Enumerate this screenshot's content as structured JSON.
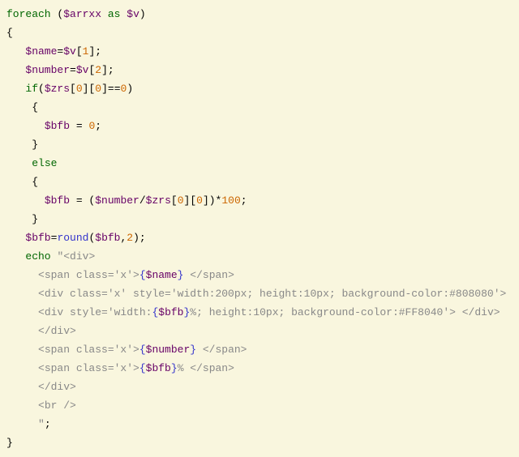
{
  "code": {
    "l1": {
      "kw1": "foreach",
      "p1": " (",
      "v1": "$arrxx",
      "p2": " ",
      "kw2": "as",
      "p3": " ",
      "v2": "$v",
      "p4": ")"
    },
    "l2": "{",
    "l3": "",
    "l4": {
      "ind": "   ",
      "v1": "$name",
      "p1": "=",
      "v2": "$v",
      "p2": "[",
      "n1": "1",
      "p3": "];"
    },
    "l5": {
      "ind": "   ",
      "v1": "$number",
      "p1": "=",
      "v2": "$v",
      "p2": "[",
      "n1": "2",
      "p3": "];"
    },
    "l6": {
      "ind": "   ",
      "kw": "if",
      "p1": "(",
      "v1": "$zrs",
      "p2": "[",
      "n1": "0",
      "p3": "][",
      "n2": "0",
      "p4": "]==",
      "n3": "0",
      "p5": ")"
    },
    "l7": {
      "ind": "    ",
      "t": "{"
    },
    "l8": {
      "ind": "      ",
      "v1": "$bfb",
      "p1": " = ",
      "n1": "0",
      "p2": ";"
    },
    "l9": {
      "ind": "    ",
      "t": "}"
    },
    "l10": {
      "ind": "    ",
      "kw": "else"
    },
    "l11": {
      "ind": "    ",
      "t": "{"
    },
    "l12": {
      "ind": "      ",
      "v1": "$bfb",
      "p1": " = (",
      "v2": "$number",
      "p2": "/",
      "v3": "$zrs",
      "p3": "[",
      "n1": "0",
      "p4": "][",
      "n2": "0",
      "p5": "])*",
      "n3": "100",
      "p6": ";"
    },
    "l13": {
      "ind": "    ",
      "t": "}"
    },
    "l14": {
      "ind": "   ",
      "v1": "$bfb",
      "p1": "=",
      "fn": "round",
      "p2": "(",
      "v2": "$bfb",
      "p3": ",",
      "n1": "2",
      "p4": ");"
    },
    "l15": {
      "ind": "   ",
      "kw": "echo",
      "sp": " ",
      "q": "\"",
      "s": "<div>"
    },
    "l16": {
      "ind": "     ",
      "s1": "<span class='x'>",
      "b1": "{",
      "v": "$name",
      "b2": "}",
      "s2": " </span>"
    },
    "l17": {
      "ind": "     ",
      "s": "<div class='x' style='width:200px; height:10px; background-color:#808080'>"
    },
    "l18": {
      "ind": "     ",
      "s1": "<div style='width:",
      "b1": "{",
      "v": "$bfb",
      "b2": "}",
      "s2": "%; height:10px; background-color:#FF8040'> </div>"
    },
    "l19": {
      "ind": "     ",
      "s": "</div>"
    },
    "l20": {
      "ind": "     ",
      "s1": "<span class='x'>",
      "b1": "{",
      "v": "$number",
      "b2": "}",
      "s2": " </span>"
    },
    "l21": {
      "ind": "     ",
      "s1": "<span class='x'>",
      "b1": "{",
      "v": "$bfb",
      "b2": "}",
      "s2": "% </span>"
    },
    "l22": {
      "ind": "     ",
      "s": "</div>"
    },
    "l23": {
      "ind": "     ",
      "s": "<br />"
    },
    "l24": {
      "ind": "     ",
      "q": "\"",
      "p": ";"
    },
    "l25": "}"
  }
}
